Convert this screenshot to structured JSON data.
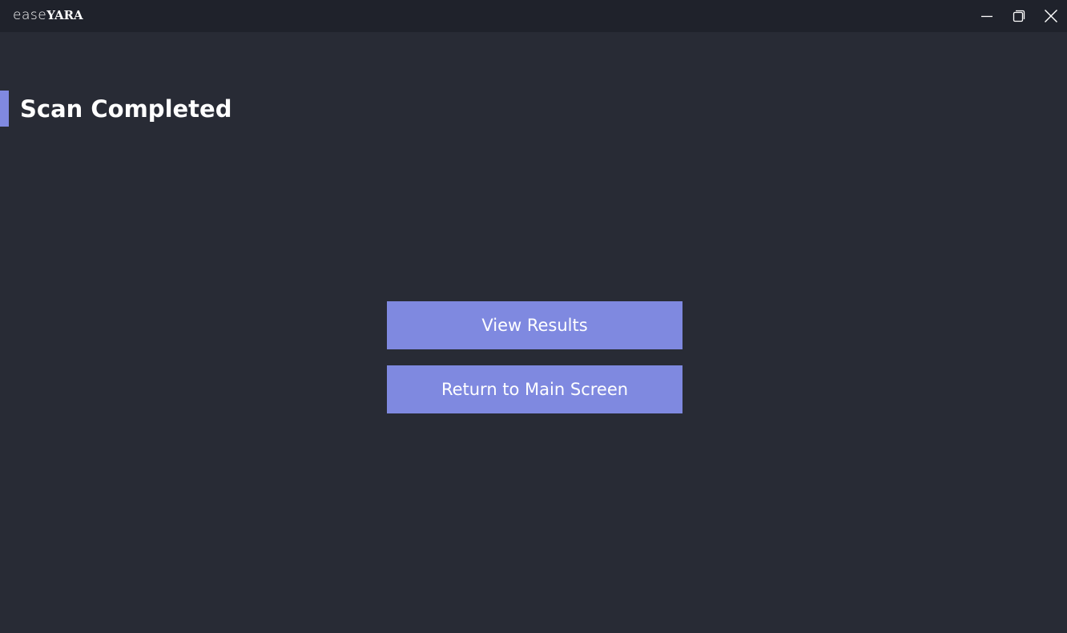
{
  "window": {
    "title_part1": "ease",
    "title_part2": "YARA",
    "controls": {
      "minimize_icon": "minimize-icon",
      "maximize_icon": "maximize-icon",
      "close_icon": "close-icon"
    }
  },
  "main": {
    "heading": "Scan Completed",
    "buttons": {
      "view_results": "View Results",
      "return_main": "Return to Main Screen"
    }
  },
  "colors": {
    "background": "#282b35",
    "titlebar": "#1f222b",
    "accent": "#7f89e0",
    "text": "#ffffff"
  }
}
